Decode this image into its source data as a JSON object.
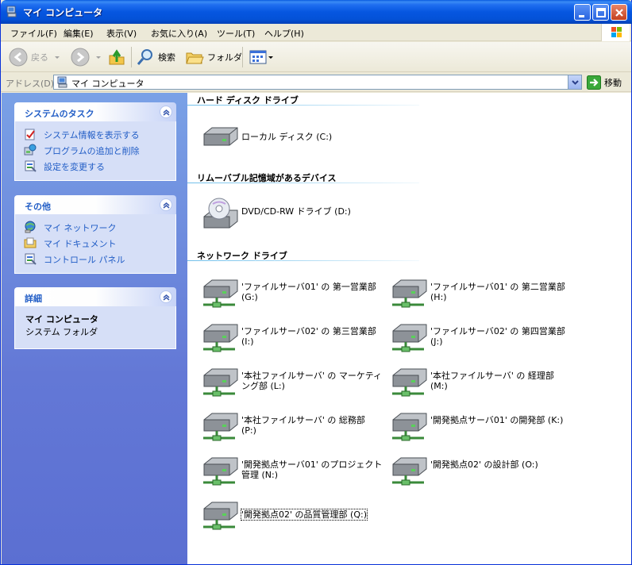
{
  "window": {
    "title": "マイ コンピュータ"
  },
  "menu": [
    "ファイル(F)",
    "編集(E)",
    "表示(V)",
    "お気に入り(A)",
    "ツール(T)",
    "ヘルプ(H)"
  ],
  "toolbar": {
    "back": "戻る",
    "search": "検索",
    "folders": "フォルダ"
  },
  "address": {
    "label": "アドレス(D)",
    "value": "マイ コンピュータ",
    "go": "移動"
  },
  "left_panels": {
    "system_tasks": {
      "title": "システムのタスク",
      "items": [
        "システム情報を表示する",
        "プログラムの追加と削除",
        "設定を変更する"
      ]
    },
    "other": {
      "title": "その他",
      "items": [
        "マイ ネットワーク",
        "マイ ドキュメント",
        "コントロール パネル"
      ]
    },
    "details": {
      "title": "詳細",
      "name": "マイ コンピュータ",
      "type": "システム フォルダ"
    }
  },
  "groups": {
    "hdd": {
      "title": "ハード ディスク ドライブ",
      "items": [
        "ローカル ディスク (C:)"
      ]
    },
    "removable": {
      "title": "リムーバブル記憶域があるデバイス",
      "items": [
        "DVD/CD-RW ドライブ (D:)"
      ]
    },
    "network": {
      "title": "ネットワーク ドライブ",
      "items": [
        "'ファイルサーバ01' の 第一営業部 (G:)",
        "'ファイルサーバ01' の 第二営業部 (H:)",
        "'ファイルサーバ02' の 第三営業部 (I:)",
        "'ファイルサーバ02' の 第四営業部 (J:)",
        "'本社ファイルサーバ' の マーケティング部 (L:)",
        "'本社ファイルサーバ' の 経理部 (M:)",
        "'本社ファイルサーバ' の 総務部 (P:)",
        "'開発拠点サーバ01' の開発部 (K:)",
        "'開発拠点サーバ01' のプロジェクト管理 (N:)",
        "'開発拠点02' の設計部 (O:)",
        "'開発拠点02' の品質管理部 (Q:)"
      ]
    }
  }
}
